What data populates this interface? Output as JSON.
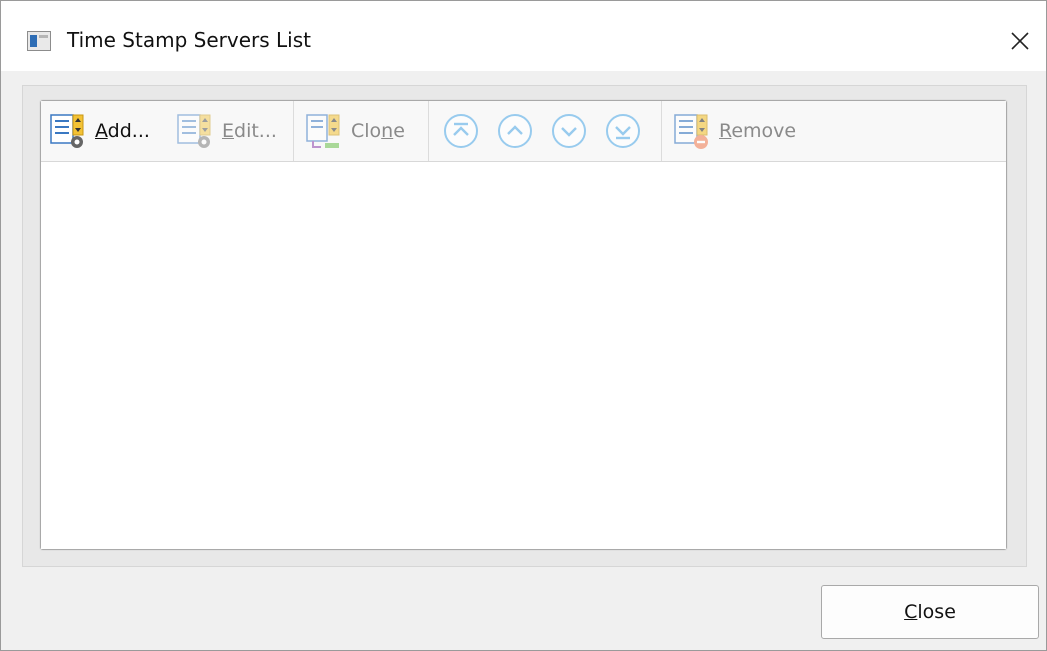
{
  "window": {
    "title": "Time Stamp Servers List"
  },
  "toolbar": {
    "add": {
      "mnemonic": "A",
      "rest": "dd..."
    },
    "edit": {
      "mnemonic": "E",
      "rest": "dit..."
    },
    "clone": {
      "pre": "Clo",
      "mnemonic": "n",
      "rest": "e"
    },
    "move_top": "move-top-icon",
    "move_up": "move-up-icon",
    "move_down": "move-down-icon",
    "move_bottom": "move-bottom-icon",
    "remove": {
      "mnemonic": "R",
      "rest": "emove"
    }
  },
  "list": {
    "items": []
  },
  "footer": {
    "close": {
      "mnemonic": "C",
      "rest": "lose"
    }
  },
  "colors": {
    "accent": "#5aaee8",
    "disabled_text": "#8a8a8a",
    "remove_badge": "#f0835b",
    "list_icon_yellow": "#f3c235"
  }
}
